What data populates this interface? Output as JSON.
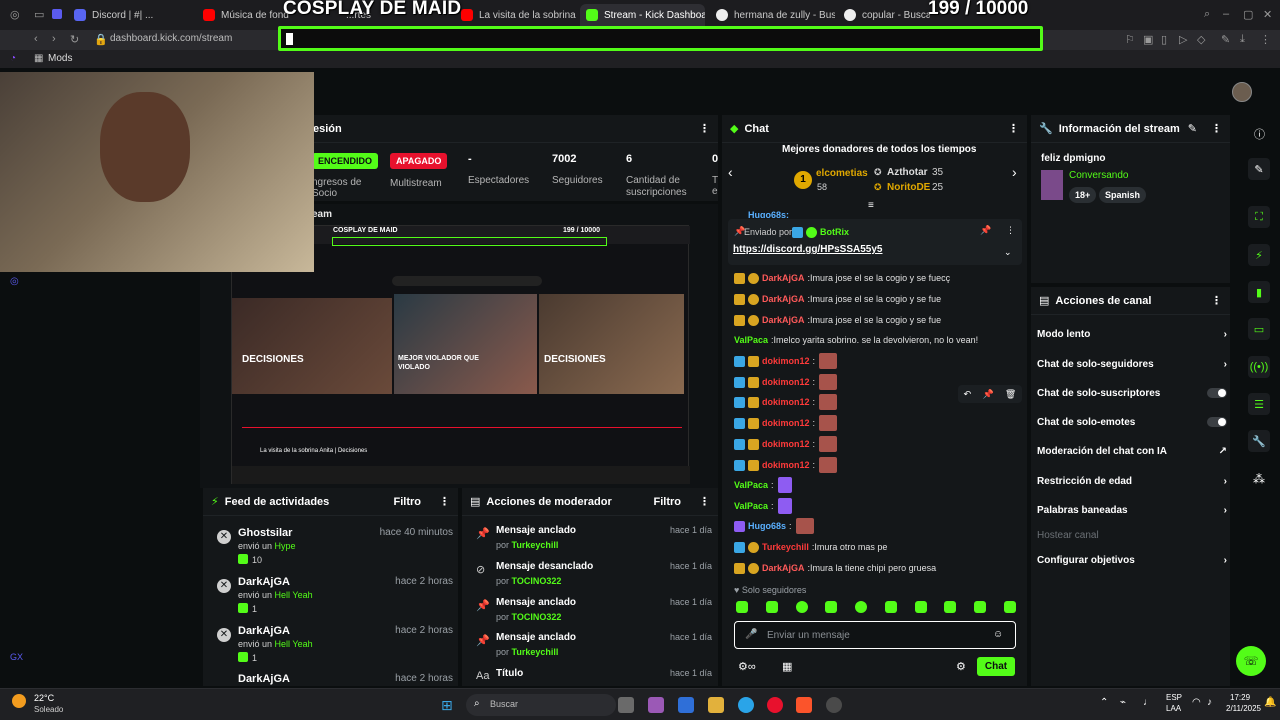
{
  "browser": {
    "tabs": [
      {
        "label": "Discord | #| ..."
      },
      {
        "label": "Música de fondo gr..."
      },
      {
        "label": "...rtes"
      },
      {
        "label": "La visita de la sobrina An"
      },
      {
        "label": "Stream - Kick Dashboard"
      },
      {
        "label": "hermana de zully - Busca"
      },
      {
        "label": "copular - Buscar co"
      }
    ],
    "url": "dashboard.kick.com/stream",
    "bookmark": "Mods"
  },
  "overlay": {
    "title": "COSPLAY DE MAID",
    "counter": "199 / 10000"
  },
  "stats": {
    "session_label": "esión",
    "encendido": "ENCENDIDO",
    "apagado": "APAGADO",
    "ingresos": "ngresos de Socio",
    "multistream": "Multistream",
    "espectadores_val": "-",
    "espectadores_lbl": "Espectadores",
    "seguidores_val": "7002",
    "seguidores_lbl": "Seguidores",
    "subs_val": "6",
    "subs_lbl": "Cantidad de suscripciones",
    "extra_val": "0",
    "extra_lbl": "T e",
    "stream_label": "eam"
  },
  "preview": {
    "title": "COSPLAY DE MAID",
    "counter": "199 / 10000",
    "videos": [
      {
        "label": "DECISIONES"
      },
      {
        "label": "MEJOR VIOLADOR QUE VIOLADO"
      },
      {
        "label": "DECISIONES"
      }
    ],
    "caption": "La visita de la sobrina Anita | Decisiones"
  },
  "feed": {
    "title": "Feed de actividades",
    "filter": "Filtro",
    "items": [
      {
        "user": "Ghostsilar",
        "time": "hace 40 minutos",
        "verb": "envió un",
        "item": "Hype",
        "amount": "10"
      },
      {
        "user": "DarkAjGA",
        "time": "hace 2 horas",
        "verb": "envió un",
        "item": "Hell Yeah",
        "amount": "1"
      },
      {
        "user": "DarkAjGA",
        "time": "hace 2 horas",
        "verb": "envió un",
        "item": "Hell Yeah",
        "amount": "1"
      },
      {
        "user": "DarkAjGA",
        "time": "hace 2 horas",
        "verb": "",
        "item": "",
        "amount": ""
      }
    ]
  },
  "mod": {
    "title": "Acciones de moderador",
    "filter": "Filtro",
    "items": [
      {
        "title": "Mensaje anclado",
        "by": "por",
        "user": "Turkeychill",
        "time": "hace 1 día"
      },
      {
        "title": "Mensaje desanclado",
        "by": "por",
        "user": "TOCINO322",
        "time": "hace 1 día"
      },
      {
        "title": "Mensaje anclado",
        "by": "por",
        "user": "TOCINO322",
        "time": "hace 1 día"
      },
      {
        "title": "Mensaje anclado",
        "by": "por",
        "user": "Turkeychill",
        "time": "hace 1 día"
      },
      {
        "title": "Título",
        "by": "",
        "user": "",
        "time": "hace 1 día"
      }
    ]
  },
  "chat": {
    "title": "Chat",
    "top_title": "Mejores donadores de todos los tiempos",
    "top1": {
      "rank": "1",
      "name": "elcometias",
      "amount": "58"
    },
    "top2": {
      "name": "Azthotar",
      "amount": "35"
    },
    "top3": {
      "name": "NoritoDE",
      "amount": "25"
    },
    "partial_user": "Hugo68s:",
    "pinned_label": "Enviado por",
    "pinned_user": "BotRix",
    "pinned_link": "https://discord.gg/HPsSSA55y5",
    "messages": [
      {
        "user": "DarkAjGA",
        "color": "#ff5a5a",
        "text": "Imura jose el se la cogio y se fuecç",
        "badges": [
          "crown",
          "one"
        ]
      },
      {
        "user": "DarkAjGA",
        "color": "#ff5a5a",
        "text": "Imura jose el se la cogio y se fue",
        "badges": [
          "crown",
          "one"
        ]
      },
      {
        "user": "DarkAjGA",
        "color": "#ff5a5a",
        "text": "Imura jose el se la cogio y se fue",
        "badges": [
          "crown",
          "one"
        ]
      },
      {
        "user": "ValPaca",
        "color": "#53fc18",
        "text": "Imelco yarita sobrino. se la devolvieron, no lo vean!",
        "badges": []
      },
      {
        "user": "dokimon12",
        "color": "#ff3a3a",
        "text": "",
        "badges": [
          "bot",
          "crown"
        ],
        "emote": true
      },
      {
        "user": "dokimon12",
        "color": "#ff3a3a",
        "text": "",
        "badges": [
          "bot",
          "crown"
        ],
        "emote": true
      },
      {
        "user": "dokimon12",
        "color": "#ff3a3a",
        "text": "",
        "badges": [
          "bot",
          "crown"
        ],
        "emote": true
      },
      {
        "user": "dokimon12",
        "color": "#ff3a3a",
        "text": "",
        "badges": [
          "bot",
          "crown"
        ],
        "emote": true
      },
      {
        "user": "dokimon12",
        "color": "#ff3a3a",
        "text": "",
        "badges": [
          "bot",
          "crown"
        ],
        "emote": true
      },
      {
        "user": "dokimon12",
        "color": "#ff3a3a",
        "text": "",
        "badges": [
          "bot",
          "crown"
        ],
        "emote": true
      },
      {
        "user": "ValPaca",
        "color": "#53fc18",
        "text": "",
        "badges": [],
        "emote": true
      },
      {
        "user": "ValPaca",
        "color": "#53fc18",
        "text": "",
        "badges": [],
        "emote": true
      },
      {
        "user": "Hugo68s",
        "color": "#5ab0ff",
        "text": "",
        "badges": [
          "purple"
        ],
        "emote": true
      },
      {
        "user": "Turkeychill",
        "color": "#ff3a3a",
        "text": "Imura otro mas pe",
        "badges": [
          "bot",
          "one"
        ]
      },
      {
        "user": "DarkAjGA",
        "color": "#ff5a5a",
        "text": "Imura la tiene chipi pero gruesa",
        "badges": [
          "crown",
          "one"
        ]
      }
    ],
    "followers_only": "Solo seguidores",
    "input_placeholder": "Enviar un mensaje",
    "send": "Chat"
  },
  "info": {
    "title": "Información del stream",
    "stream_title": "feliz dpmigno",
    "category": "Conversando",
    "tag1": "18+",
    "tag2": "Spanish"
  },
  "actions": {
    "title": "Acciones de canal",
    "items": [
      {
        "label": "Modo lento",
        "control": "arrow"
      },
      {
        "label": "Chat de solo-seguidores",
        "control": "arrow"
      },
      {
        "label": "Chat de solo-suscriptores",
        "control": "toggle"
      },
      {
        "label": "Chat de solo-emotes",
        "control": "toggle"
      },
      {
        "label": "Moderación del chat con IA",
        "control": "ext"
      },
      {
        "label": "Restricción de edad",
        "control": "arrow"
      },
      {
        "label": "Palabras baneadas",
        "control": "arrow"
      },
      {
        "label": "Hostear canal",
        "control": "none"
      },
      {
        "label": "Configurar objetivos",
        "control": "arrow"
      }
    ]
  },
  "taskbar": {
    "weather_temp": "22°C",
    "weather_desc": "Soleado",
    "search": "Buscar",
    "lang": "ESP",
    "lang2": "LAA",
    "time": "17:29",
    "date": "2/11/2025"
  },
  "colors": {
    "accent": "#53fc18",
    "panel": "#141719",
    "bg": "#0b0e0f"
  }
}
